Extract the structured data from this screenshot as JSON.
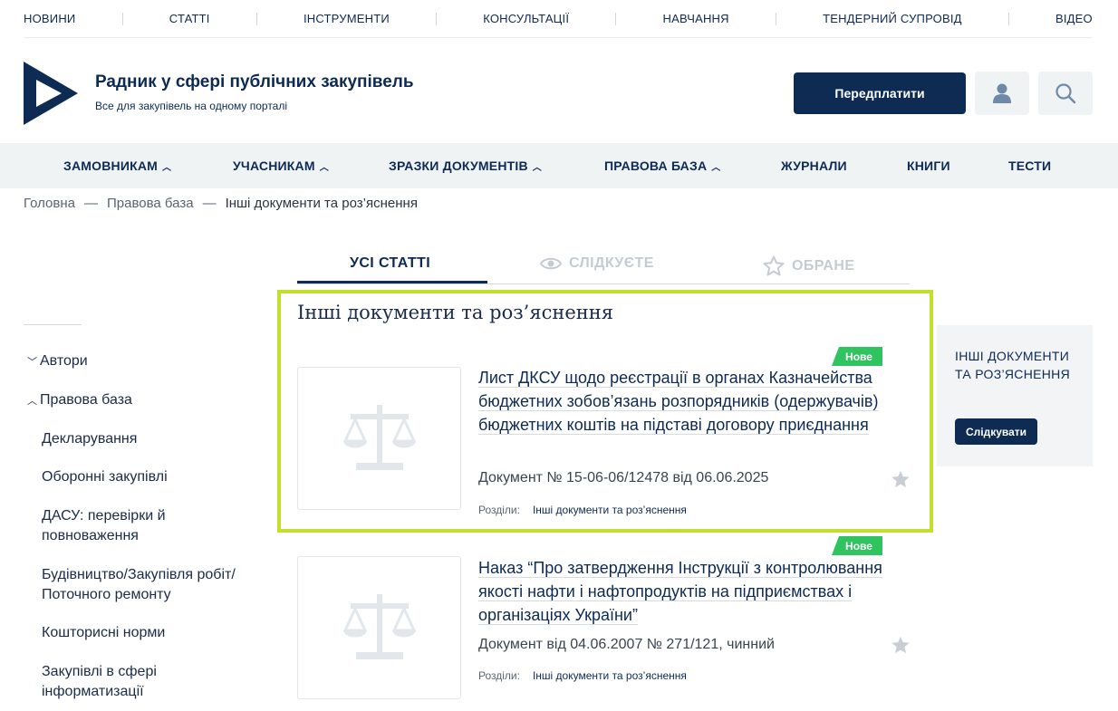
{
  "top_nav": [
    "НОВИНИ",
    "СТАТТІ",
    "ІНСТРУМЕНТИ",
    "КОНСУЛЬТАЦІЇ",
    "НАВЧАННЯ",
    "ТЕНДЕРНИЙ СУПРОВІД",
    "ВІДЕО"
  ],
  "header": {
    "title": "Радник у сфері публічних закупівель",
    "subtitle": "Все для закупівель на одному порталі",
    "subscribe_label": "Передплатити",
    "user_icon": "user-icon",
    "search_icon": "search-icon"
  },
  "main_nav": [
    "ЗАМОВНИКАМ",
    "УЧАСНИКАМ",
    "ЗРАЗКИ ДОКУМЕНТІВ",
    "ПРАВОВА БАЗА",
    "ЖУРНАЛИ",
    "КНИГИ",
    "ТЕСТИ"
  ],
  "breadcrumb": {
    "home": "Головна",
    "sep": "—",
    "parent": "Правова база",
    "current": "Інші документи та роз’яснення"
  },
  "tabs": {
    "all": "УСІ СТАТТІ",
    "following": "СЛІДКУЄТЕ",
    "favorites": "ОБРАНЕ"
  },
  "sidebar": {
    "authors": "Автори",
    "legal_base": "Правова база",
    "items": [
      "Декларування",
      "Оборонні закупівлі",
      "ДАСУ: перевірки й повноваження",
      "Будівництво/Закупівля робіт/ Поточного ремонту",
      "Кошторисні норми",
      "Закупівлі в сфері інформатизації"
    ]
  },
  "section_title": "Інші документи та роз’яснення",
  "articles": [
    {
      "badge": "Нове",
      "title": "Лист ДКСУ щодо реєстрації в органах Казначейства бюджетних зобов’язань розпорядників (одержувачів) бюджетних коштів на підставі договору приєднання",
      "meta": "Документ № 15-06-06/12478 від 06.06.2025",
      "sections_label": "Розділи:",
      "section_link": "Інші документи та роз’яснення"
    },
    {
      "badge": "Нове",
      "title": "Наказ “Про затвердження Інструкції з контролювання якості нафти і нафтопродуктів на підприємствах і організаціях України”",
      "meta": "Документ від 04.06.2007 № 271/121, чинний",
      "sections_label": "Розділи:",
      "section_link": "Інші документи та роз’яснення"
    }
  ],
  "widget": {
    "title": "ІНШІ ДОКУМЕНТИ ТА РОЗ’ЯСНЕННЯ",
    "button": "Слідкувати"
  },
  "colors": {
    "brand_navy": "#0e2b54",
    "badge_green": "#2fc460",
    "highlight_lime": "#c0e02c"
  }
}
